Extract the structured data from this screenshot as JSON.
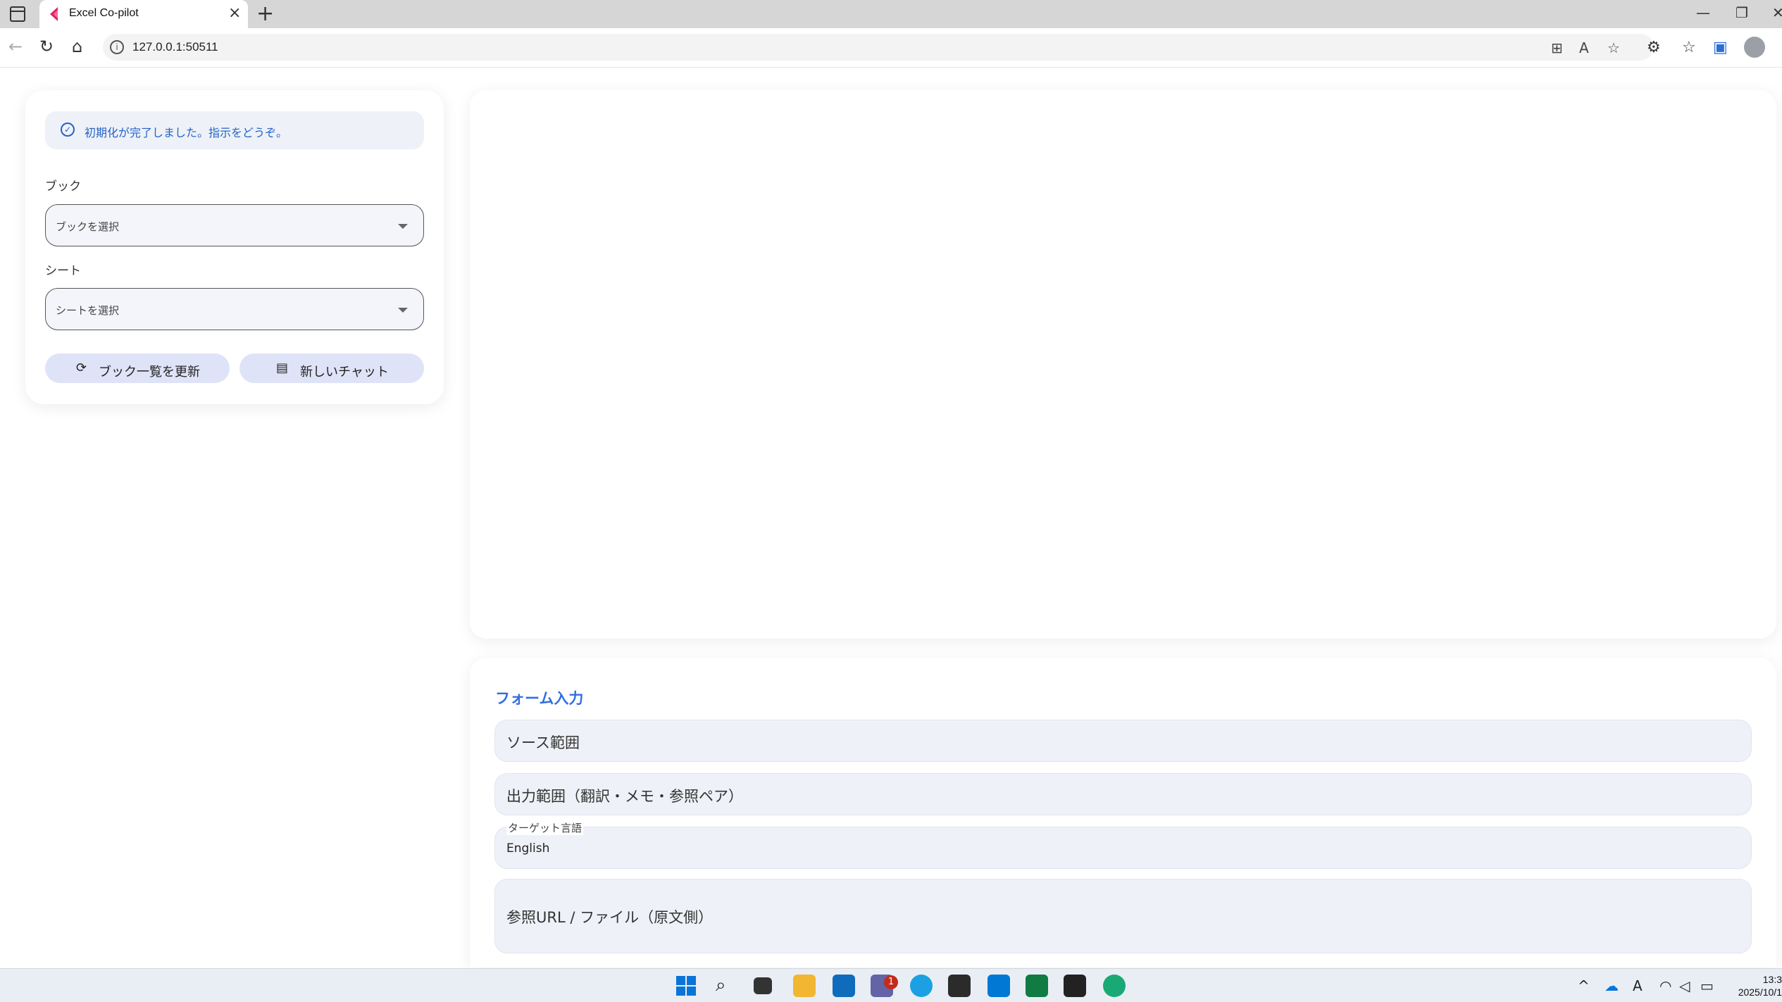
{
  "browser": {
    "tab_title": "Excel Co-pilot",
    "url": "127.0.0.1:50511"
  },
  "sidebar": {
    "status_text": "初期化が完了しました。指示をどうぞ。",
    "book_label": "ブック",
    "book_placeholder": "ブックを選択",
    "sheet_label": "シート",
    "sheet_placeholder": "シートを選択",
    "refresh_button": "ブック一覧を更新",
    "new_chat_button": "新しいチャット"
  },
  "form": {
    "title": "フォーム入力",
    "source_range": "ソース範囲",
    "output_range": "出力範囲（翻訳・メモ・参照ペア）",
    "target_language_label": "ターゲット言語",
    "target_language_value": "English",
    "reference_url": "参照URL / ファイル（原文側）"
  },
  "taskbar": {
    "badge_count": "1",
    "time": "13:3",
    "date": "2025/10/1"
  }
}
